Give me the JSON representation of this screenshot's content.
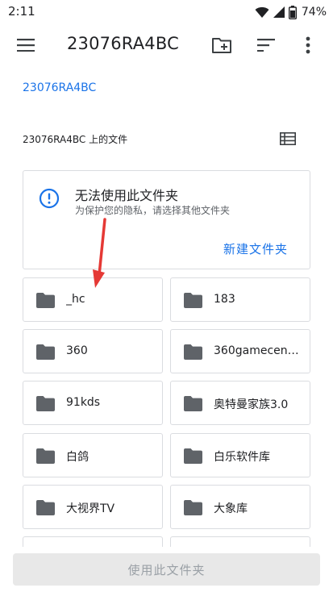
{
  "status_bar": {
    "time": "2:11",
    "battery": "74%",
    "icons": [
      "wifi-icon",
      "signal-icon",
      "battery-icon"
    ]
  },
  "app_bar": {
    "title": "23076RA4BC",
    "icons": [
      "menu-icon",
      "new-folder-icon",
      "sort-icon",
      "more-icon"
    ]
  },
  "breadcrumb": "23076RA4BC",
  "section_label": "23076RA4BC 上的文件",
  "warning": {
    "title": "无法使用此文件夹",
    "subtitle": "为保护您的隐私，请选择其他文件夹",
    "action": "新建文件夹"
  },
  "folders": [
    "_hc",
    "183",
    "360",
    "360gamecen…",
    "91kds",
    "奥特曼家族3.0",
    "白鸽",
    "白乐软件库",
    "大视界TV",
    "大象库"
  ],
  "bottom": {
    "use_folder_label": "使用此文件夹"
  },
  "colors": {
    "accent": "#1a73e8",
    "annotation": "#e53935",
    "icon": "#5f6368"
  }
}
